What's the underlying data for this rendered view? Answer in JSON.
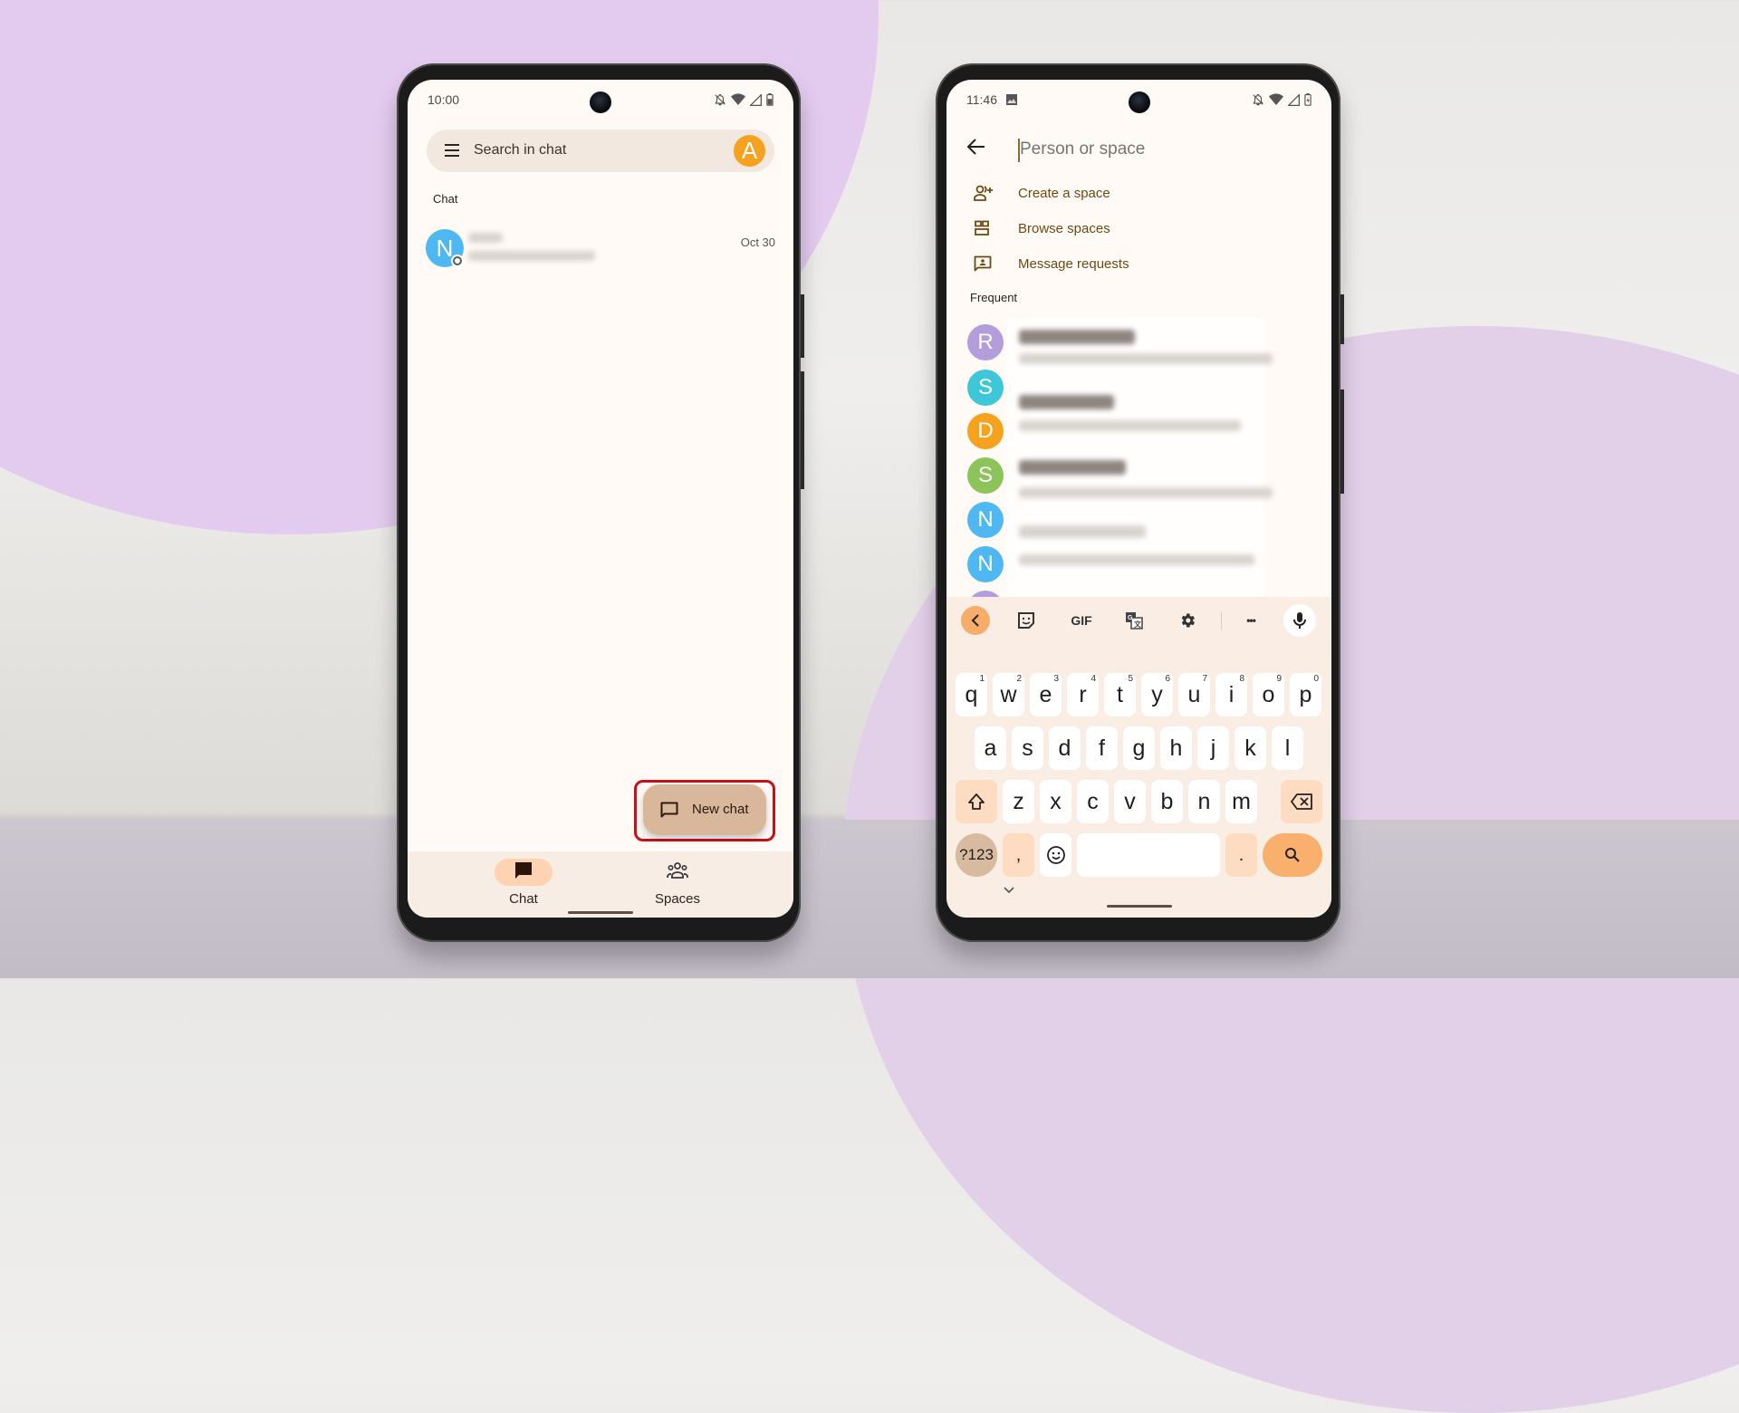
{
  "left_phone": {
    "status": {
      "time": "10:00",
      "icons": [
        "notifications-off-icon",
        "wifi-icon",
        "signal-icon",
        "battery-icon"
      ]
    },
    "search": {
      "placeholder": "Search in chat",
      "account_initial": "A",
      "account_color": "#f6a21f"
    },
    "section_label": "Chat",
    "chats": [
      {
        "initial": "N",
        "avatar_color": "#4fb8f2",
        "name": "[blurred]",
        "preview": "[blurred]",
        "date": "Oct 30",
        "presence": "away"
      }
    ],
    "fab": {
      "label": "New chat",
      "icon": "chat-bubble-outline-icon",
      "highlighted": true,
      "highlight_color": "#c8101a"
    },
    "bottom_nav": [
      {
        "label": "Chat",
        "icon": "chat-bubble-icon",
        "active": true
      },
      {
        "label": "Spaces",
        "icon": "groups-icon",
        "active": false
      }
    ]
  },
  "right_phone": {
    "status": {
      "time": "11:46",
      "icons": [
        "image-icon",
        "notifications-off-icon",
        "wifi-icon",
        "signal-icon",
        "battery-charging-icon"
      ]
    },
    "search": {
      "placeholder": "Person or space",
      "value": ""
    },
    "menu": [
      {
        "label": "Create a space",
        "icon": "group-add-icon"
      },
      {
        "label": "Browse spaces",
        "icon": "browse-grid-icon"
      },
      {
        "label": "Message requests",
        "icon": "message-request-icon"
      }
    ],
    "frequent_label": "Frequent",
    "frequent": [
      {
        "initial": "R",
        "color": "#b39ddb",
        "name": "[blurred]",
        "preview": "[blurred]"
      },
      {
        "initial": "S",
        "color": "#3ec6d9",
        "name": "[blurred]",
        "preview": "[blurred]"
      },
      {
        "initial": "D",
        "color": "#f6a21f",
        "name": "[blurred]",
        "preview": "[blurred]"
      },
      {
        "initial": "S",
        "color": "#8cc35a",
        "name": "[blurred]",
        "preview": "[blurred]"
      },
      {
        "initial": "N",
        "color": "#4fb8f2",
        "name": "[blurred]",
        "preview": "[blurred]"
      },
      {
        "initial": "N",
        "color": "#4fb8f2",
        "name": "[blurred]",
        "preview": "[blurred]"
      },
      {
        "initial": "",
        "color": "#b39ddb",
        "name": "[blurred]",
        "preview": "[blurred]"
      }
    ],
    "keyboard": {
      "toolbar": [
        "collapse-icon",
        "sticker-icon",
        "GIF",
        "translate-icon",
        "settings-icon",
        "more-icon",
        "mic-icon"
      ],
      "gif_label": "GIF",
      "more_label": "•••",
      "row1": [
        "q",
        "w",
        "e",
        "r",
        "t",
        "y",
        "u",
        "i",
        "o",
        "p"
      ],
      "row1_hints": [
        "1",
        "2",
        "3",
        "4",
        "5",
        "6",
        "7",
        "8",
        "9",
        "0"
      ],
      "row2": [
        "a",
        "s",
        "d",
        "f",
        "g",
        "h",
        "j",
        "k",
        "l"
      ],
      "row3": [
        "z",
        "x",
        "c",
        "v",
        "b",
        "n",
        "m"
      ],
      "symbols_label": "?123",
      "comma": ",",
      "period": ".",
      "accent_color": "#f8b06c"
    }
  }
}
